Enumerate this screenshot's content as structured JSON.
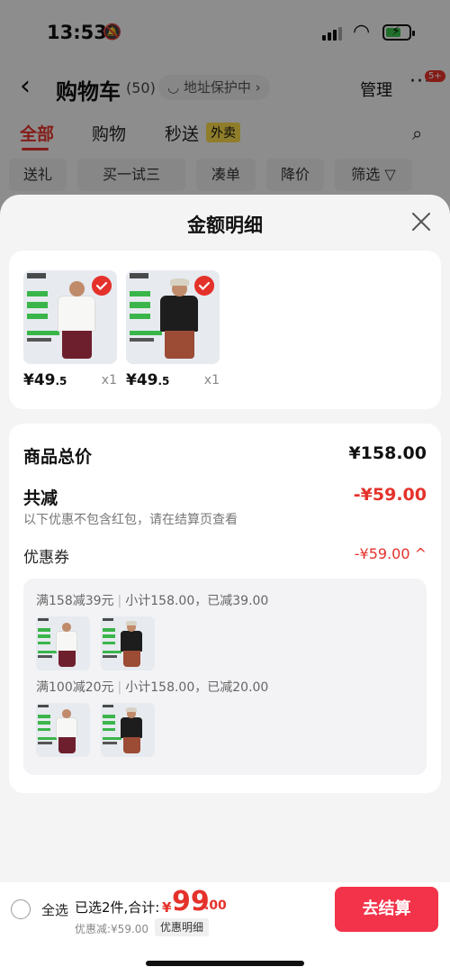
{
  "status_bar": {
    "time": "13:53"
  },
  "nav": {
    "title": "购物车",
    "count": "(50)",
    "address_protect": "◡ 地址保护中 ›",
    "manage": "管理",
    "more_badge": "5+"
  },
  "tabs": [
    {
      "label": "全部",
      "active": true
    },
    {
      "label": "购物",
      "active": false
    },
    {
      "label": "秒送",
      "active": false
    }
  ],
  "tab_badge": "外卖",
  "chips": [
    "送礼",
    "买一试三",
    "凑单",
    "降价",
    "筛选 ▽"
  ],
  "sheet": {
    "title": "金额明细",
    "products": [
      {
        "price_int": "¥49",
        "price_dec": ".5",
        "qty": "x1",
        "shirt": "white",
        "pants": "maroon"
      },
      {
        "price_int": "¥49",
        "price_dec": ".5",
        "qty": "x1",
        "shirt": "black",
        "pants": "rust"
      }
    ],
    "summary": {
      "total_label": "商品总价",
      "total_value": "¥158.00",
      "reduce_label": "共减",
      "reduce_value": "-¥59.00",
      "note": "以下优惠不包含红包，请在结算页查看",
      "coupon_label": "优惠券",
      "coupon_value": "-¥59.00 ^",
      "coupon_lines": [
        {
          "rule": "满158减39元",
          "detail": "小计158.00，已减39.00"
        },
        {
          "rule": "满100减20元",
          "detail": "小计158.00，已减20.00"
        }
      ]
    }
  },
  "bottom_bar": {
    "select_all": "全选",
    "selected": "已选2件,合计:",
    "currency": "¥",
    "total_int": "99",
    "total_dec": ".00",
    "discount": "优惠减:¥59.00",
    "detail_link": "优惠明细",
    "checkout": "去结算"
  },
  "colors": {
    "accent": "#e4322b",
    "checkout": "#f2334a"
  }
}
